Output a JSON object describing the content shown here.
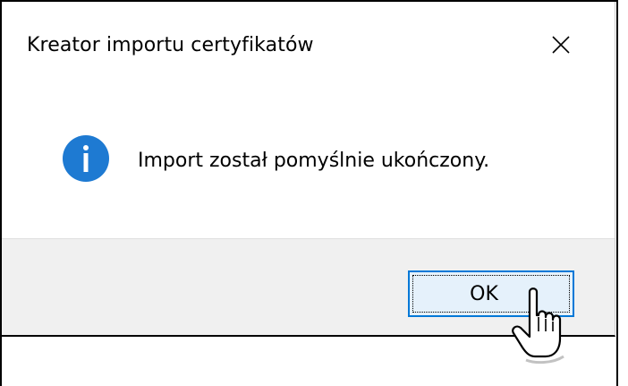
{
  "dialog": {
    "title": "Kreator importu certyfikatów",
    "message": "Import został pomyślnie ukończony.",
    "ok_label": "OK"
  },
  "icons": {
    "close": "close-icon",
    "info": "info-icon",
    "cursor": "hand-pointer-cursor"
  },
  "colors": {
    "info_blue": "#1e7ad2",
    "button_border": "#0078d7",
    "button_fill": "#e5f1fb",
    "footer_bg": "#f0f0f0"
  }
}
